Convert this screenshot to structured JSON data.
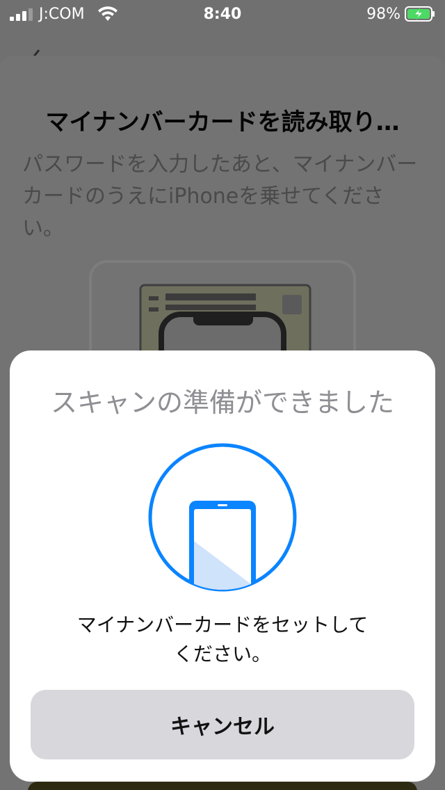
{
  "status_bar": {
    "carrier": "J:COM",
    "time": "8:40",
    "battery_percent": "98%",
    "battery_level": 0.98,
    "battery_charging": true
  },
  "background_sheet": {
    "title": "マイナンバーカードを読み取り…",
    "description": "パスワードを入力したあと、マイナンバーカードのうえにiPhoneを乗せてください。"
  },
  "scan_modal": {
    "title": "スキャンの準備ができました",
    "icon": "phone-scan-icon",
    "accent_color": "#0a84ff",
    "message_line1": "マイナンバーカードをセットして",
    "message_line2": "ください。",
    "cancel_label": "キャンセル"
  }
}
